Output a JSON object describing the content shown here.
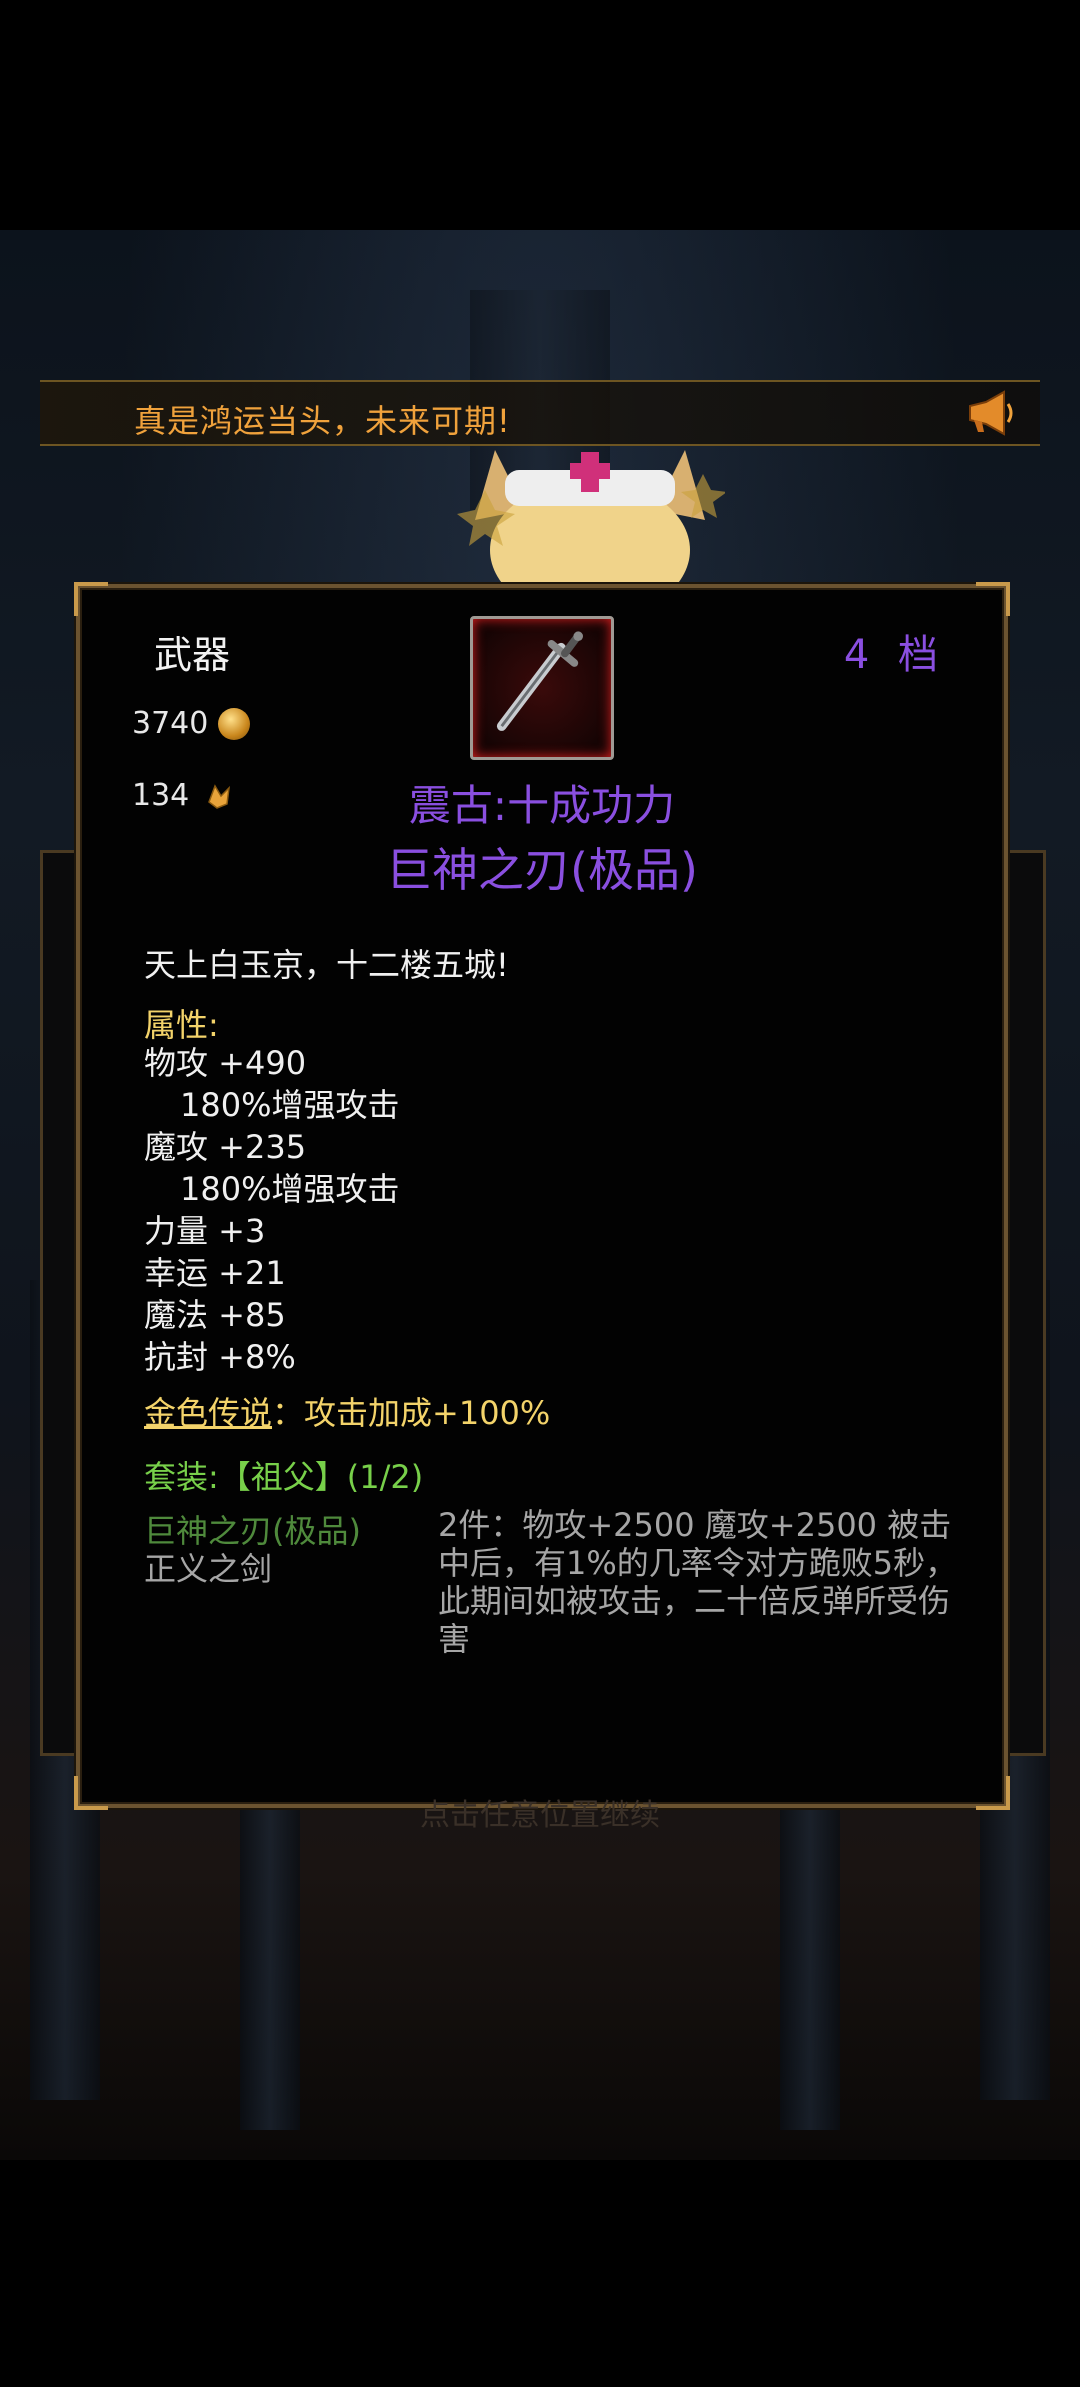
{
  "banner": {
    "text": "真是鸿运当头，未来可期!",
    "icon": "horn-icon"
  },
  "item": {
    "category": "武器",
    "tier": "4 档",
    "gold": "3740",
    "shards": "134",
    "set_title": "震古:十成功力",
    "name": "巨神之刃(极品)",
    "description": "天上白玉京，十二楼五城!",
    "attr_title": "属性:",
    "stats": [
      "物攻 +490",
      "180%增强攻击",
      "魔攻 +235",
      "180%增强攻击",
      "力量 +3",
      "幸运 +21",
      "魔法 +85",
      "抗封 +8%"
    ],
    "legendary_name": "金色传说",
    "legendary_effect": "：攻击加成+100%",
    "set_line": "套装:【祖父】(1/2)",
    "set_items": [
      "巨神之刃(极品)",
      "正义之剑"
    ],
    "set_bonus": "2件：物攻+2500 魔攻+2500 被击中后，有1%的几率令对方跪败5秒，此期间如被攻击，二十倍反弹所受伤害"
  },
  "footer": {
    "continue": "点击任意位置继续"
  },
  "colors": {
    "purple": "#8a4fe0",
    "gold": "#f3d36a",
    "green": "#78d04a",
    "banner": "#f0a23c"
  }
}
